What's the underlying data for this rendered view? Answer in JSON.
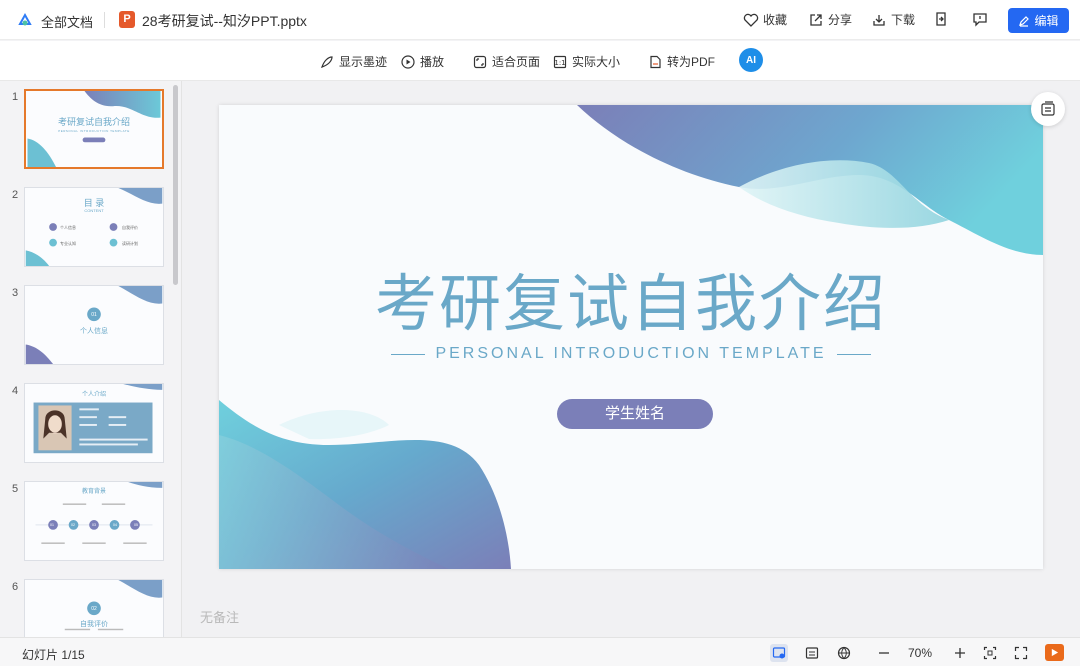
{
  "header": {
    "all_docs": "全部文档",
    "file_icon": "P",
    "file_name": "28考研复试--知汐PPT.pptx",
    "favorite": "收藏",
    "share": "分享",
    "download": "下载",
    "edit": "编辑"
  },
  "toolbar": {
    "show_ink": "显示墨迹",
    "play": "播放",
    "fit_page": "适合页面",
    "actual_size": "实际大小",
    "to_pdf": "转为PDF",
    "ai": "AI"
  },
  "thumbnails": [
    {
      "num": "1",
      "title": "考研复试自我介绍",
      "sub": "PERSONAL INTRODUCTION TEMPLATE"
    },
    {
      "num": "2",
      "title": "目 录",
      "sub": "CONTENT",
      "items": [
        "个人信息",
        "自我评价",
        "专业认知",
        "读研计划"
      ]
    },
    {
      "num": "3",
      "title": "个人信息",
      "badge": "01"
    },
    {
      "num": "4",
      "title": "个人介绍"
    },
    {
      "num": "5",
      "title": "教育背景",
      "circles": [
        "01",
        "02",
        "03",
        "04",
        "05"
      ]
    },
    {
      "num": "6",
      "title": "自我评价",
      "badge": "02"
    }
  ],
  "slide": {
    "title": "考研复试自我介绍",
    "subtitle": "PERSONAL INTRODUCTION TEMPLATE",
    "name_button": "学生姓名"
  },
  "notes": "无备注",
  "footer": {
    "slide_count": "幻灯片 1/15",
    "zoom": "70%"
  },
  "colors": {
    "accent_blue": "#2468f2",
    "theme_teal": "#6aa8c8",
    "theme_purple": "#7b7fb8",
    "ppt_orange": "#e5592b"
  }
}
